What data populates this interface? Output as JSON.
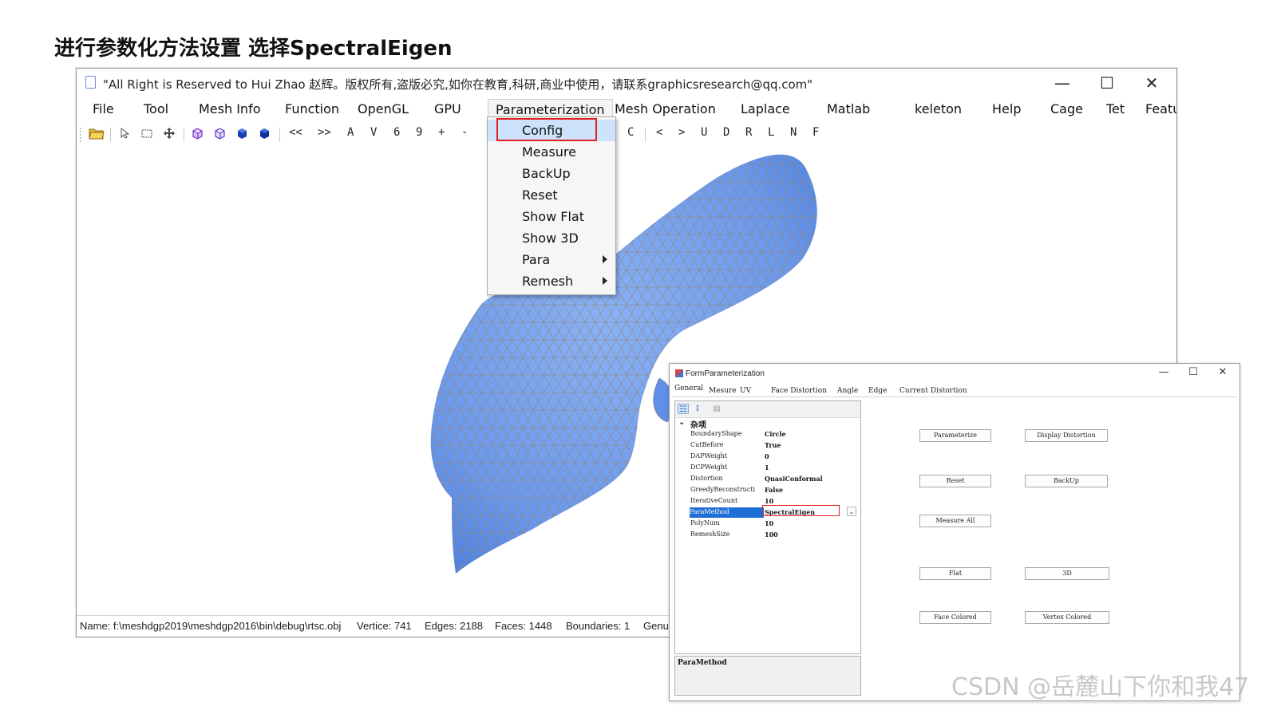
{
  "heading": "进行参数化方法设置 选择SpectralEigen",
  "window": {
    "title": "\"All Right is Reserved to Hui Zhao 赵辉。版权所有,盗版必究,如你在教育,科研,商业中使用，请联系graphicsresearch@qq.com\"",
    "minimize": "—",
    "maximize": "☐",
    "close": "✕"
  },
  "menu": [
    "File",
    "Tool",
    "Mesh Info",
    "Function",
    "OpenGL",
    "GPU",
    "Parameterization",
    "Mesh Operation",
    "Laplace",
    "Matlab",
    "keleton",
    "Help",
    "Cage",
    "Tet",
    "Featu"
  ],
  "toolbar": {
    "left_text": [
      "<<",
      ">>",
      "A",
      "V",
      "6",
      "9",
      "+",
      "-"
    ],
    "right_text": [
      "C",
      "<",
      ">",
      "U",
      "D",
      "R",
      "L",
      "N",
      "F"
    ],
    "icons": [
      "open-folder-icon",
      "select-arrow-icon",
      "rect-select-icon",
      "move-icon",
      "wire-cube-icon",
      "wire-cube-icon",
      "solid-cube-icon",
      "solid-cube-icon"
    ]
  },
  "dropdown": {
    "items": [
      {
        "label": "Config",
        "submenu": false
      },
      {
        "label": "Measure",
        "submenu": false
      },
      {
        "label": "BackUp",
        "submenu": false
      },
      {
        "label": "Reset",
        "submenu": false
      },
      {
        "label": "Show Flat",
        "submenu": false
      },
      {
        "label": "Show 3D",
        "submenu": false
      },
      {
        "label": "Para",
        "submenu": true
      },
      {
        "label": "Remesh",
        "submenu": true
      }
    ]
  },
  "status": {
    "name": "Name: f:\\meshdgp2019\\meshdgp2016\\bin\\debug\\rtsc.obj",
    "vertices": "Vertice: 741",
    "edges": "Edges: 2188",
    "faces": "Faces: 1448",
    "boundaries": "Boundaries: 1",
    "genus": "Genus"
  },
  "form": {
    "title": "FormParameterization",
    "minimize": "—",
    "maximize": "☐",
    "close": "✕",
    "tabs": [
      "General",
      "Mesure",
      "UV",
      "Face Distortion",
      "Angle",
      "Edge",
      "Current Distortion"
    ],
    "category": "杂项",
    "properties": [
      {
        "name": "BoundaryShape",
        "value": "Circle"
      },
      {
        "name": "CutBefore",
        "value": "True"
      },
      {
        "name": "DAPWeight",
        "value": "0"
      },
      {
        "name": "DCPWeight",
        "value": "1"
      },
      {
        "name": "Distortion",
        "value": "QuasiConformal"
      },
      {
        "name": "GreedyReconstructi",
        "value": "False"
      },
      {
        "name": "IterativeCount",
        "value": "10"
      },
      {
        "name": "ParaMethod",
        "value": "SpectralEigen"
      },
      {
        "name": "PolyNum",
        "value": "10"
      },
      {
        "name": "RemeshSize",
        "value": "100"
      }
    ],
    "description": "ParaMethod",
    "buttons": {
      "parameterize": "Parameterize",
      "display_distortion": "Display Distortion",
      "reset": "Reset",
      "backup": "BackUp",
      "measure_all": "Measure All",
      "flat": "Flat",
      "three_d": "3D",
      "face_colored": "Face Colored",
      "vertex_colored": "Vertex Colored"
    }
  },
  "watermark": "CSDN @岳麓山下你和我47",
  "colors": {
    "mesh_fill": "#6d9df0",
    "mesh_wire": "#9a8c7a",
    "highlight_red": "#e02020",
    "selected_blue": "#1e6ed6"
  }
}
